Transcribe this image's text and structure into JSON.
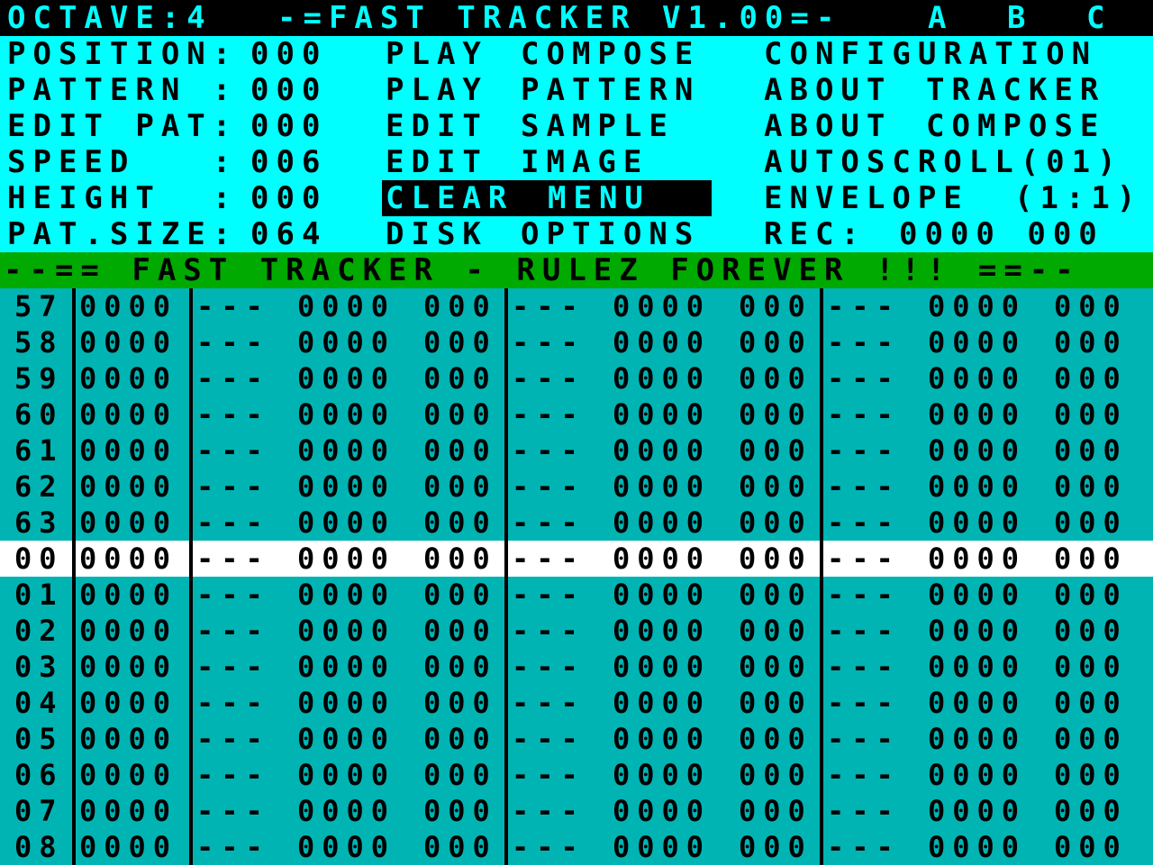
{
  "header": {
    "octave": "OCTAVE:4",
    "title": "-=FAST TRACKER V1.00=-",
    "channels": [
      "A",
      "B",
      "C"
    ]
  },
  "status": [
    {
      "label": "POSITION:",
      "value": "000"
    },
    {
      "label": "PATTERN :",
      "value": "000"
    },
    {
      "label": "EDIT PAT:",
      "value": "000"
    },
    {
      "label": "SPEED   :",
      "value": "006"
    },
    {
      "label": "HEIGHT  :",
      "value": "000"
    },
    {
      "label": "PAT.SIZE:",
      "value": "064"
    }
  ],
  "menu_middle": [
    {
      "a": "PLAY",
      "b": "COMPOSE"
    },
    {
      "a": "PLAY",
      "b": "PATTERN"
    },
    {
      "a": "EDIT",
      "b": "SAMPLE"
    },
    {
      "a": "EDIT",
      "b": "IMAGE"
    },
    {
      "a": "CLEAR",
      "b": "MENU"
    },
    {
      "a": "DISK",
      "b": "OPTIONS"
    }
  ],
  "menu_right": [
    {
      "a": "CONFIGURATION",
      "b": ""
    },
    {
      "a": "ABOUT",
      "b": "TRACKER"
    },
    {
      "a": "ABOUT",
      "b": "COMPOSE"
    },
    {
      "a": "AUTOSCROLL(01)",
      "b": ""
    },
    {
      "a": "ENVELOPE",
      "b": "(1:1)"
    },
    {
      "a": "REC:",
      "b": "0000 000"
    }
  ],
  "banner": "--== FAST TRACKER - RULEZ FOREVER !!! ==--",
  "pattern": {
    "current_row": "00",
    "rows": [
      {
        "num": "57",
        "sample": "0000",
        "a_note": "---",
        "a_val": "0000",
        "a_eff": "000",
        "b_note": "---",
        "b_val": "0000",
        "b_eff": "000",
        "c_note": "---",
        "c_val": "0000",
        "c_eff": "000"
      },
      {
        "num": "58",
        "sample": "0000",
        "a_note": "---",
        "a_val": "0000",
        "a_eff": "000",
        "b_note": "---",
        "b_val": "0000",
        "b_eff": "000",
        "c_note": "---",
        "c_val": "0000",
        "c_eff": "000"
      },
      {
        "num": "59",
        "sample": "0000",
        "a_note": "---",
        "a_val": "0000",
        "a_eff": "000",
        "b_note": "---",
        "b_val": "0000",
        "b_eff": "000",
        "c_note": "---",
        "c_val": "0000",
        "c_eff": "000"
      },
      {
        "num": "60",
        "sample": "0000",
        "a_note": "---",
        "a_val": "0000",
        "a_eff": "000",
        "b_note": "---",
        "b_val": "0000",
        "b_eff": "000",
        "c_note": "---",
        "c_val": "0000",
        "c_eff": "000"
      },
      {
        "num": "61",
        "sample": "0000",
        "a_note": "---",
        "a_val": "0000",
        "a_eff": "000",
        "b_note": "---",
        "b_val": "0000",
        "b_eff": "000",
        "c_note": "---",
        "c_val": "0000",
        "c_eff": "000"
      },
      {
        "num": "62",
        "sample": "0000",
        "a_note": "---",
        "a_val": "0000",
        "a_eff": "000",
        "b_note": "---",
        "b_val": "0000",
        "b_eff": "000",
        "c_note": "---",
        "c_val": "0000",
        "c_eff": "000"
      },
      {
        "num": "63",
        "sample": "0000",
        "a_note": "---",
        "a_val": "0000",
        "a_eff": "000",
        "b_note": "---",
        "b_val": "0000",
        "b_eff": "000",
        "c_note": "---",
        "c_val": "0000",
        "c_eff": "000"
      },
      {
        "num": "00",
        "sample": "0000",
        "a_note": "---",
        "a_val": "0000",
        "a_eff": "000",
        "b_note": "---",
        "b_val": "0000",
        "b_eff": "000",
        "c_note": "---",
        "c_val": "0000",
        "c_eff": "000"
      },
      {
        "num": "01",
        "sample": "0000",
        "a_note": "---",
        "a_val": "0000",
        "a_eff": "000",
        "b_note": "---",
        "b_val": "0000",
        "b_eff": "000",
        "c_note": "---",
        "c_val": "0000",
        "c_eff": "000"
      },
      {
        "num": "02",
        "sample": "0000",
        "a_note": "---",
        "a_val": "0000",
        "a_eff": "000",
        "b_note": "---",
        "b_val": "0000",
        "b_eff": "000",
        "c_note": "---",
        "c_val": "0000",
        "c_eff": "000"
      },
      {
        "num": "03",
        "sample": "0000",
        "a_note": "---",
        "a_val": "0000",
        "a_eff": "000",
        "b_note": "---",
        "b_val": "0000",
        "b_eff": "000",
        "c_note": "---",
        "c_val": "0000",
        "c_eff": "000"
      },
      {
        "num": "04",
        "sample": "0000",
        "a_note": "---",
        "a_val": "0000",
        "a_eff": "000",
        "b_note": "---",
        "b_val": "0000",
        "b_eff": "000",
        "c_note": "---",
        "c_val": "0000",
        "c_eff": "000"
      },
      {
        "num": "05",
        "sample": "0000",
        "a_note": "---",
        "a_val": "0000",
        "a_eff": "000",
        "b_note": "---",
        "b_val": "0000",
        "b_eff": "000",
        "c_note": "---",
        "c_val": "0000",
        "c_eff": "000"
      },
      {
        "num": "06",
        "sample": "0000",
        "a_note": "---",
        "a_val": "0000",
        "a_eff": "000",
        "b_note": "---",
        "b_val": "0000",
        "b_eff": "000",
        "c_note": "---",
        "c_val": "0000",
        "c_eff": "000"
      },
      {
        "num": "07",
        "sample": "0000",
        "a_note": "---",
        "a_val": "0000",
        "a_eff": "000",
        "b_note": "---",
        "b_val": "0000",
        "b_eff": "000",
        "c_note": "---",
        "c_val": "0000",
        "c_eff": "000"
      },
      {
        "num": "08",
        "sample": "0000",
        "a_note": "---",
        "a_val": "0000",
        "a_eff": "000",
        "b_note": "---",
        "b_val": "0000",
        "b_eff": "000",
        "c_note": "---",
        "c_val": "0000",
        "c_eff": "000"
      }
    ]
  },
  "colors": {
    "menu_bg": "#00ffff",
    "banner_bg": "#00aa00",
    "grid_bg": "#00b4b4",
    "current_row_bg": "#ffffff",
    "ink": "#000000"
  }
}
